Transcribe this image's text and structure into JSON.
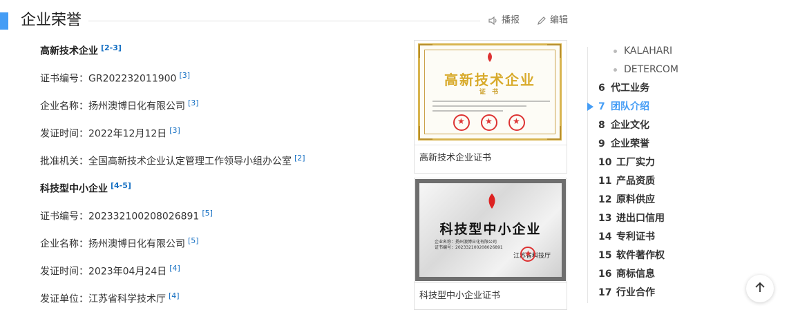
{
  "section": {
    "title": "企业荣誉"
  },
  "toolbar": {
    "play_label": "播报",
    "edit_label": "编辑"
  },
  "entries": [
    {
      "text": "高新技术企业",
      "ref": "[2-3]",
      "heading": true
    },
    {
      "text": "证书编号：GR202232011900",
      "ref": "[3]"
    },
    {
      "text": "企业名称：扬州澳博日化有限公司",
      "ref": "[3]"
    },
    {
      "text": "发证时间：2022年12月12日",
      "ref": "[3]"
    },
    {
      "text": "批准机关：全国高新技术企业认定管理工作领导小组办公室",
      "ref": "[2]"
    },
    {
      "text": "科技型中小企业",
      "ref": "[4-5]",
      "heading": true
    },
    {
      "text": "证书编号：202332100208026891",
      "ref": "[5]"
    },
    {
      "text": "企业名称：扬州澳博日化有限公司",
      "ref": "[5]"
    },
    {
      "text": "发证时间：2023年04月24日",
      "ref": "[4]"
    },
    {
      "text": "发证单位：江苏省科学技术厅",
      "ref": "[4]"
    }
  ],
  "figures": [
    {
      "caption": "高新技术企业证书",
      "cert_title": "高新技术企业",
      "cert_subtitle": "证 书"
    },
    {
      "caption": "科技型中小企业证书",
      "cert_title": "科技型中小企业",
      "cert_lines": [
        "企业名称：扬州澳博日化有限公司",
        "证书编号：202332100208026891"
      ],
      "cert_org": "江苏省科技厅"
    }
  ],
  "toc": {
    "sub_items": [
      "KALAHARI",
      "DETERCOM"
    ],
    "items": [
      {
        "num": "6",
        "label": "代工业务"
      },
      {
        "num": "7",
        "label": "团队介绍",
        "active": true
      },
      {
        "num": "8",
        "label": "企业文化"
      },
      {
        "num": "9",
        "label": "企业荣誉"
      },
      {
        "num": "10",
        "label": "工厂实力"
      },
      {
        "num": "11",
        "label": "产品资质"
      },
      {
        "num": "12",
        "label": "原料供应"
      },
      {
        "num": "13",
        "label": "进出口信用"
      },
      {
        "num": "14",
        "label": "专利证书"
      },
      {
        "num": "15",
        "label": "软件著作权"
      },
      {
        "num": "16",
        "label": "商标信息"
      },
      {
        "num": "17",
        "label": "行业合作"
      }
    ]
  },
  "colors": {
    "accent": "#459df5",
    "ref_link": "#136ec2",
    "cert_gold": "#d8aa2b",
    "seal_red": "#dd3333"
  },
  "icons": {
    "play": "speaker-icon",
    "edit": "pencil-icon",
    "back_to_top": "arrow-up-icon"
  }
}
